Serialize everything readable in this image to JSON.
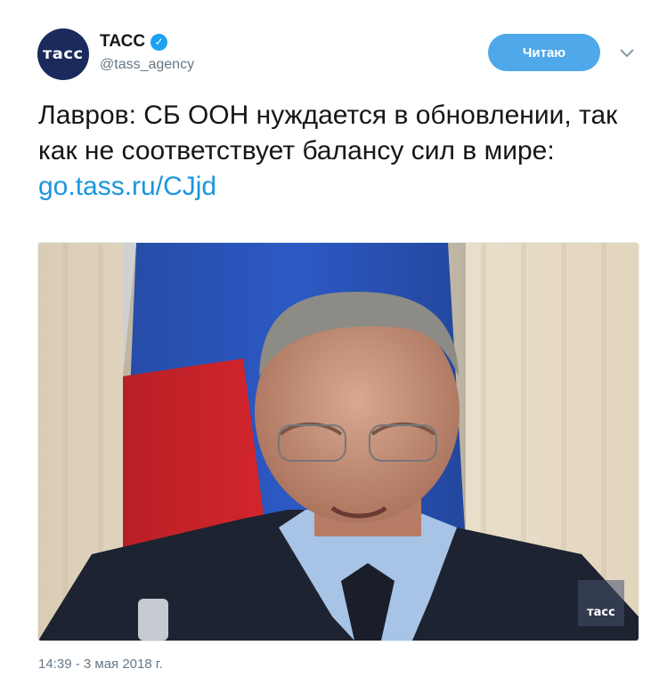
{
  "tweet": {
    "author": {
      "avatar_text": "тасс",
      "display_name": "ТАСС",
      "handle": "@tass_agency",
      "verified": true
    },
    "follow_button_label": "Читаю",
    "text": "Лавров: СБ ООН нуждается в обновлении, так как не соответствует балансу сил в мире:",
    "link": "go.tass.ru/CJjd",
    "media": {
      "watermark": "тасс"
    },
    "timestamp": "14:39 - 3 мая 2018 г."
  },
  "colors": {
    "accent": "#1da1f2",
    "link": "#1b95e0",
    "button": "#4ea8ea",
    "muted": "#657786",
    "avatar_bg": "#1b2a5c"
  },
  "icons": {
    "verified": "verified-badge-icon",
    "menu": "chevron-down-icon"
  }
}
